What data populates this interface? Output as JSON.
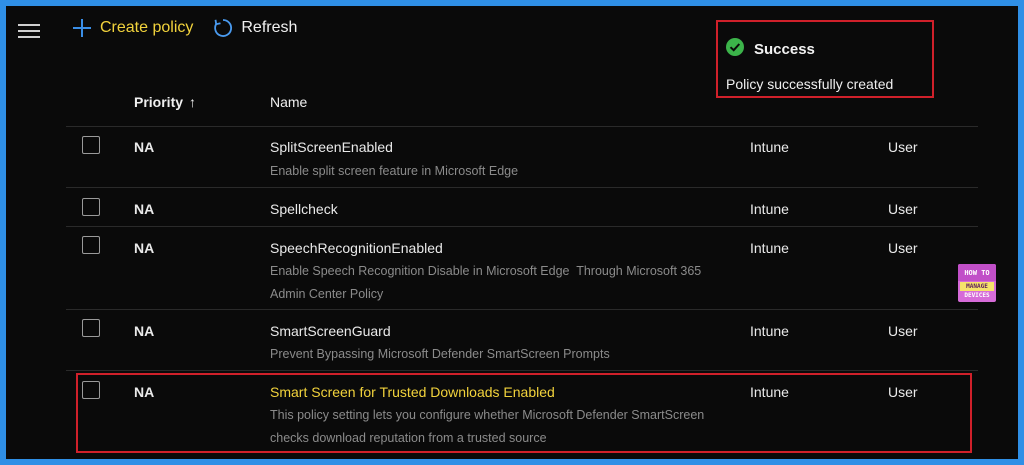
{
  "toolbar": {
    "create_label": "Create policy",
    "refresh_label": "Refresh"
  },
  "toast": {
    "title": "Success",
    "message": "Policy successfully created"
  },
  "table": {
    "columns": {
      "priority": "Priority",
      "priority_sort": "↑",
      "name": "Name"
    },
    "rows": [
      {
        "priority": "NA",
        "name": "SplitScreenEnabled",
        "description_lines": [
          "Enable split screen feature in Microsoft Edge"
        ],
        "platform": "Intune",
        "target": "User"
      },
      {
        "priority": "NA",
        "name": "Spellcheck",
        "description_lines": [],
        "platform": "Intune",
        "target": "User"
      },
      {
        "priority": "NA",
        "name": "SpeechRecognitionEnabled",
        "description_lines": [
          "Enable Speech Recognition Disable in Microsoft Edge  Through Microsoft 365",
          "Admin Center Policy"
        ],
        "platform": "Intune",
        "target": "User"
      },
      {
        "priority": "NA",
        "name": "SmartScreenGuard",
        "description_lines": [
          "Prevent Bypassing Microsoft Defender SmartScreen Prompts"
        ],
        "platform": "Intune",
        "target": "User"
      },
      {
        "priority": "NA",
        "name": "Smart Screen for Trusted Downloads Enabled",
        "description_lines": [
          "This policy setting lets you configure whether Microsoft Defender SmartScreen",
          "checks download reputation from a trusted source"
        ],
        "platform": "Intune",
        "target": "User"
      }
    ]
  },
  "logo": {
    "line1": "HOW TO",
    "line2": "MANAGE",
    "line3": "DEVICES"
  },
  "colors": {
    "accent": "#f2d33c",
    "highlight": "#d0202a",
    "success": "#3cb44a",
    "create_icon": "#3a8ee6",
    "refresh_icon": "#4a9bf0"
  }
}
